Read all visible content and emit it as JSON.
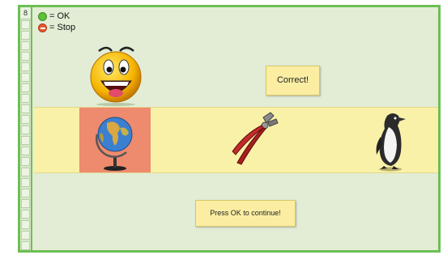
{
  "progress": {
    "trial_number": "8",
    "cell_count": 22
  },
  "legend": {
    "ok_label": "= OK",
    "stop_label": "= Stop",
    "ok_color": "#5fbf3a",
    "stop_color": "#e8572f"
  },
  "feedback": {
    "text": "Correct!",
    "icon": "smiley-face-icon"
  },
  "choices": [
    {
      "icon": "globe-icon",
      "selected": true,
      "highlight_color": "#ee8a6e"
    },
    {
      "icon": "pliers-icon",
      "selected": false
    },
    {
      "icon": "penguin-icon",
      "selected": false
    }
  ],
  "continue_prompt": {
    "text": "Press OK to continue!"
  },
  "colors": {
    "background": "#e3edd6",
    "frame_border": "#6cbf52",
    "choice_strip": "#faf1a8",
    "message_box": "#fbeea3"
  }
}
